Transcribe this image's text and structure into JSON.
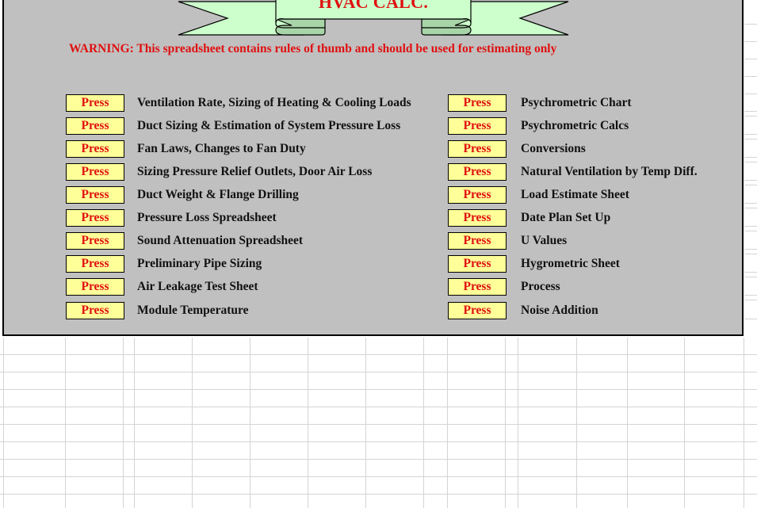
{
  "banner": {
    "title": "HVAC CALC."
  },
  "warning": "WARNING: This spreadsheet contains rules of thumb and should be used for estimating only",
  "colors": {
    "panel_bg": "#c0c0c0",
    "banner_fill": "#ccffcc",
    "banner_fold": "#a8d5a8",
    "button_bg": "#ffff99",
    "accent_red": "#e01010"
  },
  "left_column": [
    {
      "button": "Press",
      "label": "Ventilation Rate, Sizing of Heating & Cooling Loads"
    },
    {
      "button": "Press",
      "label": "Duct Sizing & Estimation of System Pressure Loss"
    },
    {
      "button": "Press",
      "label": "Fan Laws, Changes to Fan Duty"
    },
    {
      "button": "Press",
      "label": "Sizing Pressure Relief Outlets, Door Air Loss"
    },
    {
      "button": "Press",
      "label": "Duct Weight & Flange Drilling"
    },
    {
      "button": "Press",
      "label": "Pressure Loss Spreadsheet"
    },
    {
      "button": "Press",
      "label": "Sound Attenuation Spreadsheet"
    },
    {
      "button": "Press",
      "label": "Preliminary Pipe Sizing"
    },
    {
      "button": "Press",
      "label": "Air Leakage Test Sheet"
    },
    {
      "button": "Press",
      "label": "Module Temperature"
    }
  ],
  "right_column": [
    {
      "button": "Press",
      "label": "Psychrometric Chart"
    },
    {
      "button": "Press",
      "label": "Psychrometric Calcs"
    },
    {
      "button": "Press",
      "label": "Conversions"
    },
    {
      "button": "Press",
      "label": "Natural Ventilation by Temp Diff."
    },
    {
      "button": "Press",
      "label": "Load Estimate Sheet"
    },
    {
      "button": "Press",
      "label": "Date Plan Set Up"
    },
    {
      "button": "Press",
      "label": "U Values"
    },
    {
      "button": "Press",
      "label": "Hygrometric Sheet"
    },
    {
      "button": "Press",
      "label": "Process"
    },
    {
      "button": "Press",
      "label": "Noise Addition"
    }
  ]
}
